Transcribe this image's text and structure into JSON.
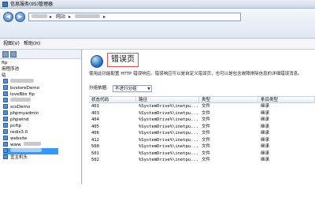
{
  "window": {
    "title": "信息服务(IIS)管理器"
  },
  "address": {
    "segments": [
      "",
      "网站",
      ""
    ]
  },
  "menubar": {
    "items": [
      "视图(V)",
      "帮助(H)"
    ]
  },
  "sidebar": {
    "items": [
      {
        "label": "用程序池"
      },
      {
        "label": ""
      },
      {
        "label": "bvstoreDemo"
      },
      {
        "label": "loveBbs ftp"
      },
      {
        "label": ""
      },
      {
        "label": "scsDemo"
      },
      {
        "label": "phpmyadmin"
      },
      {
        "label": "phpwind"
      },
      {
        "label": "pcftp"
      },
      {
        "label": "redis3.0"
      },
      {
        "label": "website"
      },
      {
        "label": "www."
      },
      {
        "label": "宜主机头"
      }
    ],
    "visible_headers": [
      "ftp",
      "站"
    ]
  },
  "main": {
    "title": "错误页",
    "description": "使用此功能配置 HTTP 错误响应。错误响应可以是自定义错误页，也可以是包含故障排除信息的详细错误消息。",
    "group_label": "分组依据:",
    "group_value": "不进行分组",
    "columns": [
      "状态代码",
      "路径",
      "类型",
      "条目类型"
    ],
    "rows": [
      {
        "code": "401",
        "path": "%SystemDrive%\\inetpu...",
        "type": "文件",
        "entry": "继承"
      },
      {
        "code": "403",
        "path": "%SystemDrive%\\inetpu...",
        "type": "文件",
        "entry": "继承"
      },
      {
        "code": "404",
        "path": "%SystemDrive%\\inetpu...",
        "type": "文件",
        "entry": "继承"
      },
      {
        "code": "405",
        "path": "%SystemDrive%\\inetpu...",
        "type": "文件",
        "entry": "继承"
      },
      {
        "code": "406",
        "path": "%SystemDrive%\\inetpu...",
        "type": "文件",
        "entry": "继承"
      },
      {
        "code": "412",
        "path": "%SystemDrive%\\inetpu...",
        "type": "文件",
        "entry": "继承"
      },
      {
        "code": "500",
        "path": "%SystemDrive%\\inetpu...",
        "type": "文件",
        "entry": "继承"
      },
      {
        "code": "501",
        "path": "%SystemDrive%\\inetpu...",
        "type": "文件",
        "entry": "继承"
      },
      {
        "code": "502",
        "path": "%SystemDrive%\\inetpu...",
        "type": "文件",
        "entry": "继承"
      }
    ]
  },
  "colors": {
    "accent": "#3399ff",
    "title_border": "#d9534f"
  }
}
